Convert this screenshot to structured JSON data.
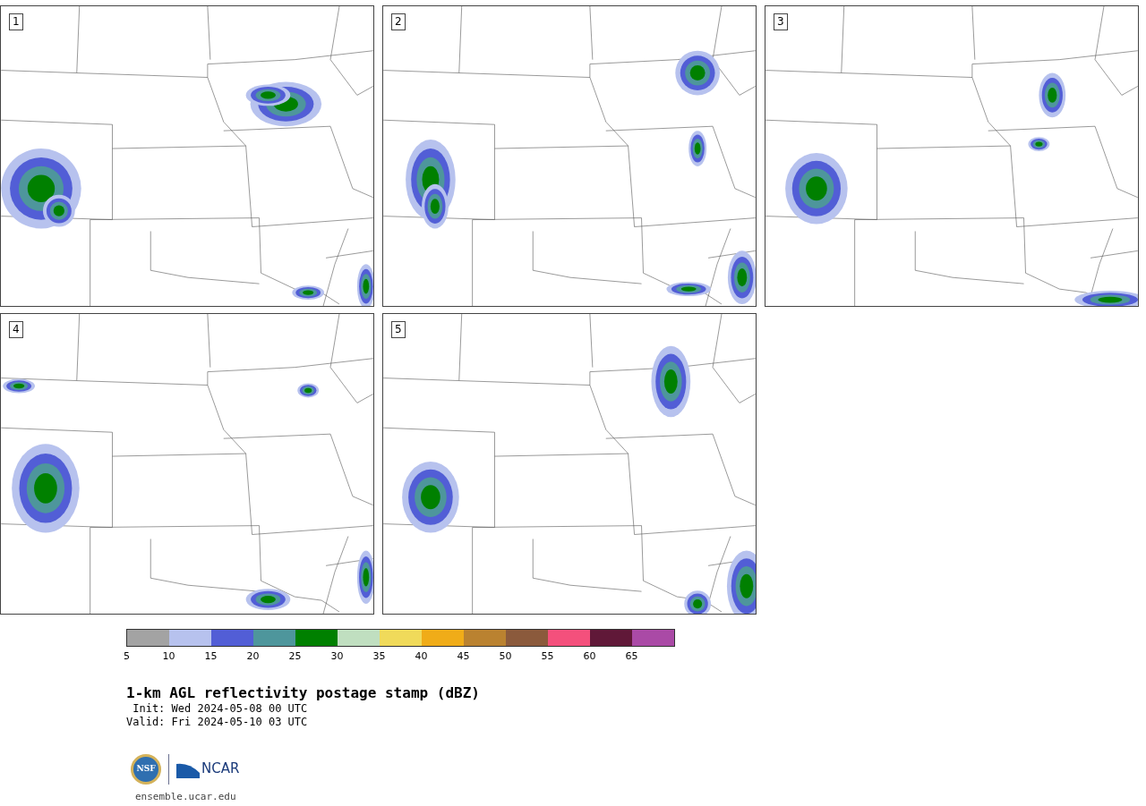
{
  "panels": [
    {
      "label": "1"
    },
    {
      "label": "2"
    },
    {
      "label": "3"
    },
    {
      "label": "4"
    },
    {
      "label": "5"
    }
  ],
  "colorbar": {
    "bins": [
      {
        "color": "#a3a3a3"
      },
      {
        "color": "#b7c2ee"
      },
      {
        "color": "#525ed6"
      },
      {
        "color": "#4e969c"
      },
      {
        "color": "#008000"
      },
      {
        "color": "#c0dfc0"
      },
      {
        "color": "#f0da5a"
      },
      {
        "color": "#f0ac18"
      },
      {
        "color": "#ba8230"
      },
      {
        "color": "#8b5a3c"
      },
      {
        "color": "#f4507c"
      },
      {
        "color": "#601838"
      },
      {
        "color": "#aa4aa6"
      }
    ],
    "ticks": [
      "5",
      "10",
      "15",
      "20",
      "25",
      "30",
      "35",
      "40",
      "45",
      "50",
      "55",
      "60",
      "65"
    ]
  },
  "title": "1-km AGL reflectivity postage stamp (dBZ)",
  "init": " Init: Wed 2024-05-08 00 UTC",
  "valid": "Valid: Fri 2024-05-10 03 UTC",
  "logos": {
    "nsf": "NSF",
    "ncar": "NCAR"
  },
  "url": "ensemble.ucar.edu"
}
